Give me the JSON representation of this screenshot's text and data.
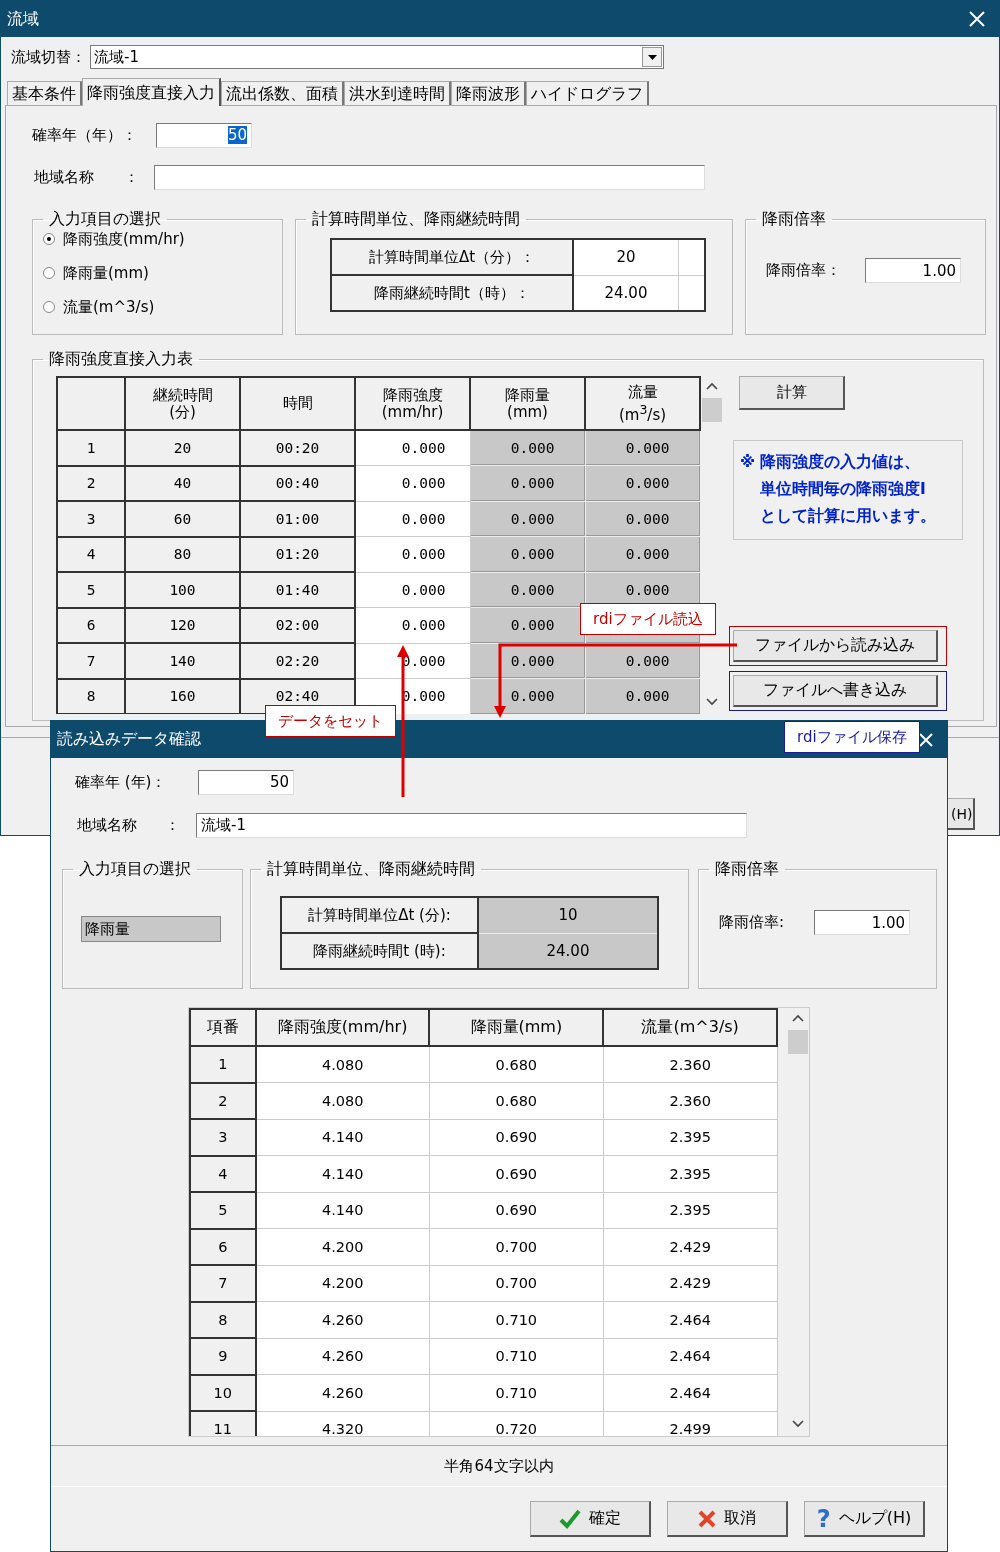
{
  "main_window": {
    "title": "流域",
    "basin_switch": {
      "label": "流域切替：",
      "value": "流域-1"
    },
    "tabs": [
      {
        "label": "基本条件",
        "selected": false
      },
      {
        "label": "降雨強度直接入力",
        "selected": true
      },
      {
        "label": "流出係数、面積",
        "selected": false
      },
      {
        "label": "洪水到達時間",
        "selected": false
      },
      {
        "label": "降雨波形",
        "selected": false
      },
      {
        "label": "ハイドログラフ",
        "selected": false
      }
    ],
    "probability_year": {
      "label": "確率年（年）：",
      "value": "50",
      "highlighted": true
    },
    "region_name": {
      "label": "地域名称",
      "colon": "："
    },
    "input_selection": {
      "title": "入力項目の選択",
      "options": [
        {
          "label": "降雨強度(mm/hr)",
          "selected": true
        },
        {
          "label": "降雨量(mm)",
          "selected": false
        },
        {
          "label": "流量(m^3/s)",
          "selected": false
        }
      ]
    },
    "time_group": {
      "title": "計算時間単位、降雨継続時間",
      "rows": [
        {
          "label": "計算時間単位Δt（分）：",
          "value": "20"
        },
        {
          "label": "降雨継続時間t（時）：",
          "value": "24.00"
        }
      ]
    },
    "rain_factor": {
      "title": "降雨倍率",
      "label": "降雨倍率：",
      "value": "1.00"
    },
    "table_group": {
      "title": "降雨強度直接入力表",
      "columns": [
        {
          "kind": "index"
        },
        {
          "lines": [
            "継続時間",
            "(分)"
          ],
          "kind": "plain"
        },
        {
          "lines": [
            "時間"
          ],
          "kind": "plain"
        },
        {
          "lines": [
            "降雨強度",
            "(mm/hr)"
          ],
          "kind": "input"
        },
        {
          "lines": [
            "降雨量",
            "(mm)"
          ],
          "kind": "computed"
        },
        {
          "lines": [
            "流量",
            "(m$^{3}$/s)"
          ],
          "kind": "computed"
        }
      ],
      "rows": [
        [
          "1",
          "20",
          "00:20",
          "0.000",
          "0.000",
          "0.000"
        ],
        [
          "2",
          "40",
          "00:40",
          "0.000",
          "0.000",
          "0.000"
        ],
        [
          "3",
          "60",
          "01:00",
          "0.000",
          "0.000",
          "0.000"
        ],
        [
          "4",
          "80",
          "01:20",
          "0.000",
          "0.000",
          "0.000"
        ],
        [
          "5",
          "100",
          "01:40",
          "0.000",
          "0.000",
          "0.000"
        ],
        [
          "6",
          "120",
          "02:00",
          "0.000",
          "0.000",
          null
        ],
        [
          "7",
          "140",
          "02:20",
          "0.000",
          "0.000",
          "0.000"
        ],
        [
          "8",
          "160",
          "02:40",
          "0.000",
          "0.000",
          "0.000"
        ]
      ]
    },
    "calc_button": "計算",
    "note": [
      "※ 降雨強度の入力値は、",
      "単位時間毎の降雨強度I",
      "として計算に用います。"
    ],
    "file_buttons": [
      {
        "label": "ファイルから読み込み",
        "color": "#c00000"
      },
      {
        "label": "ファイルへ書き込み",
        "color": "#1a1a9a"
      }
    ],
    "help_button": "(H)"
  },
  "callouts": [
    {
      "text": "rdiファイル読込",
      "color": "#c00000"
    },
    {
      "text": "データをセット",
      "color": "#c00000"
    },
    {
      "text": "rdiファイル保存",
      "color": "#1a1a9a"
    }
  ],
  "dialog": {
    "title": "読み込みデータ確認",
    "probability_year": {
      "label": "確率年 (年)：",
      "value": "50"
    },
    "region_name": {
      "label": "地域名称",
      "colon": "：",
      "value": "流域-1"
    },
    "input_selection": {
      "title": "入力項目の選択",
      "value": "降雨量"
    },
    "time_group": {
      "title": "計算時間単位、降雨継続時間",
      "rows": [
        {
          "label": "計算時間単位Δt (分):",
          "value": "10"
        },
        {
          "label": "降雨継続時間t (時):",
          "value": "24.00"
        }
      ]
    },
    "rain_factor": {
      "title": "降雨倍率",
      "label": "降雨倍率:",
      "value": "1.00"
    },
    "columns": [
      "項番",
      "降雨強度(mm/hr)",
      "降雨量(mm)",
      "流量(m^3/s)"
    ],
    "rows": [
      [
        "1",
        "4.080",
        "0.680",
        "2.360"
      ],
      [
        "2",
        "4.080",
        "0.680",
        "2.360"
      ],
      [
        "3",
        "4.140",
        "0.690",
        "2.395"
      ],
      [
        "4",
        "4.140",
        "0.690",
        "2.395"
      ],
      [
        "5",
        "4.140",
        "0.690",
        "2.395"
      ],
      [
        "6",
        "4.200",
        "0.700",
        "2.429"
      ],
      [
        "7",
        "4.200",
        "0.700",
        "2.429"
      ],
      [
        "8",
        "4.260",
        "0.710",
        "2.464"
      ],
      [
        "9",
        "4.260",
        "0.710",
        "2.464"
      ],
      [
        "10",
        "4.260",
        "0.710",
        "2.464"
      ],
      [
        "11",
        "4.320",
        "0.720",
        "2.499"
      ]
    ],
    "status": "半角64文字以内",
    "buttons": [
      {
        "label": "確定",
        "kind": "ok"
      },
      {
        "label": "取消",
        "kind": "cancel"
      },
      {
        "label": "ヘルプ(H)",
        "kind": "help",
        "icon": "?"
      }
    ]
  }
}
